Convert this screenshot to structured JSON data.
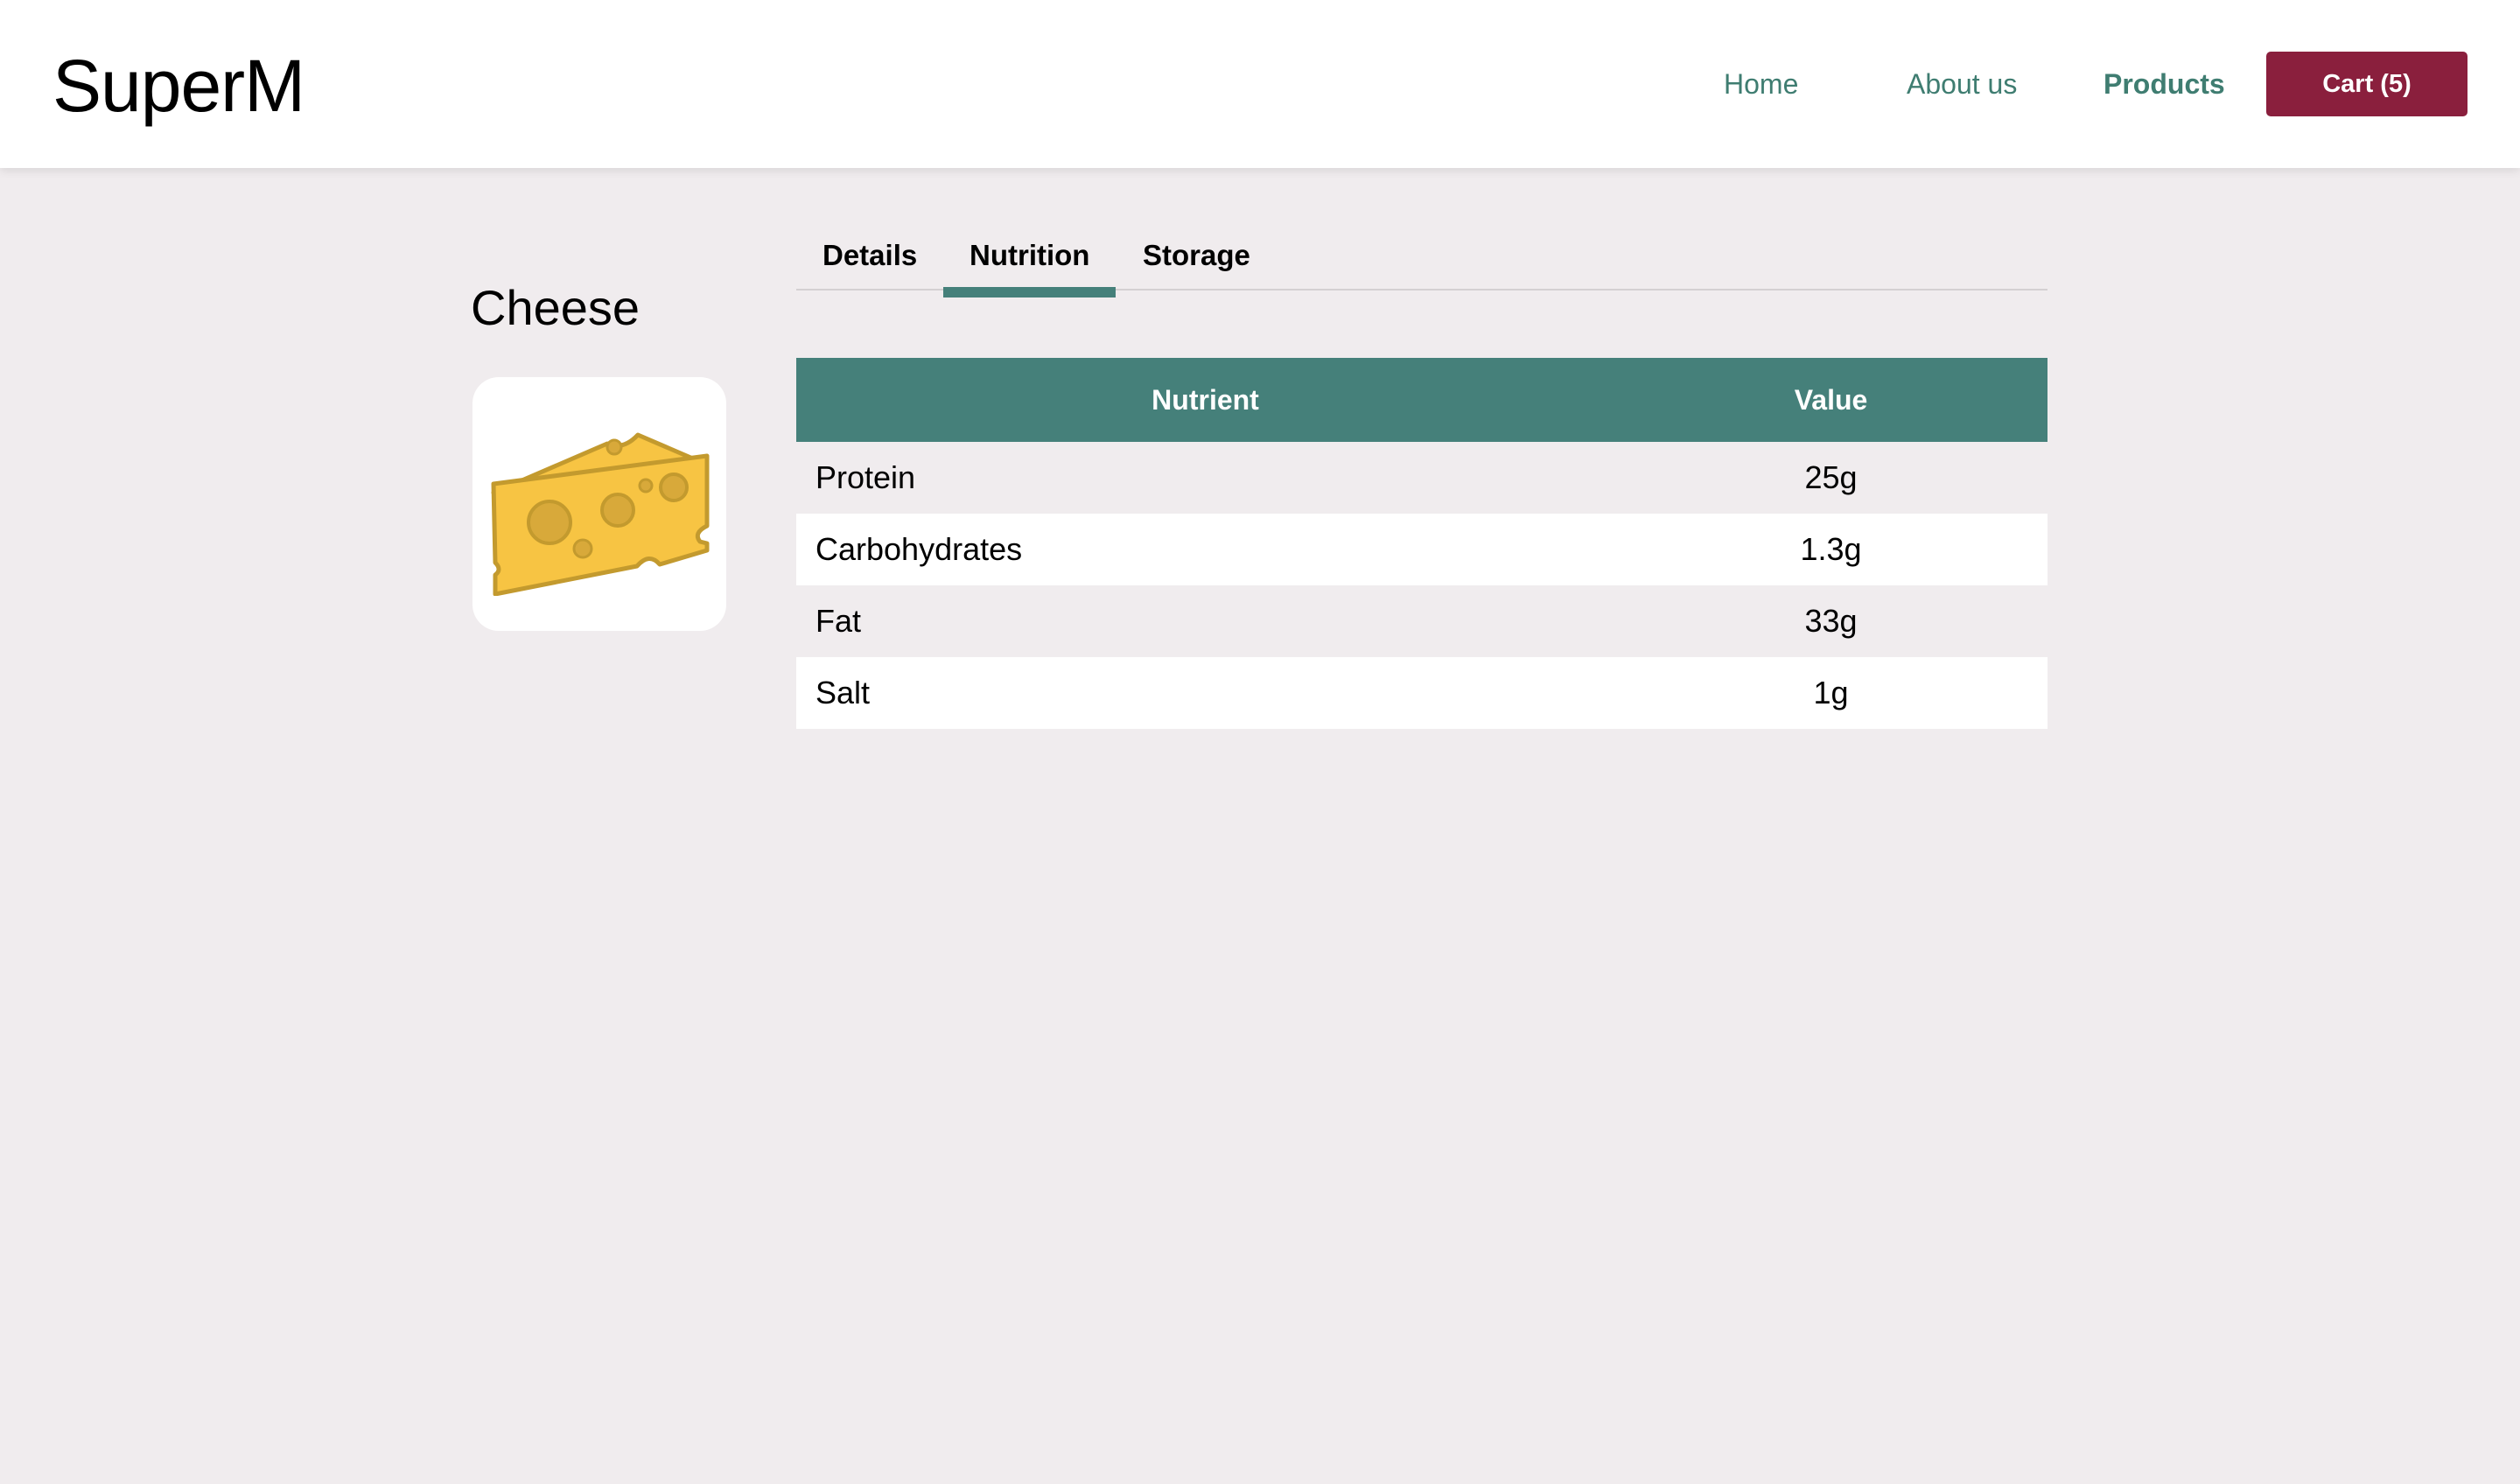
{
  "header": {
    "logo": "SuperM",
    "nav": {
      "home": "Home",
      "about": "About us",
      "products": "Products"
    },
    "cart_label": "Cart (5)",
    "accent_color": "#3f7d71",
    "cart_color": "#8a1f3d"
  },
  "product": {
    "name": "Cheese",
    "image_icon": "cheese-wedge-icon"
  },
  "tabs": [
    {
      "label": "Details",
      "active": false
    },
    {
      "label": "Nutrition",
      "active": true
    },
    {
      "label": "Storage",
      "active": false
    }
  ],
  "nutrition_table": {
    "columns": [
      "Nutrient",
      "Value"
    ],
    "header_color": "#45807a",
    "rows": [
      {
        "nutrient": "Protein",
        "value": "25g"
      },
      {
        "nutrient": "Carbohydrates",
        "value": "1.3g"
      },
      {
        "nutrient": "Fat",
        "value": "33g"
      },
      {
        "nutrient": "Salt",
        "value": "1g"
      }
    ]
  }
}
